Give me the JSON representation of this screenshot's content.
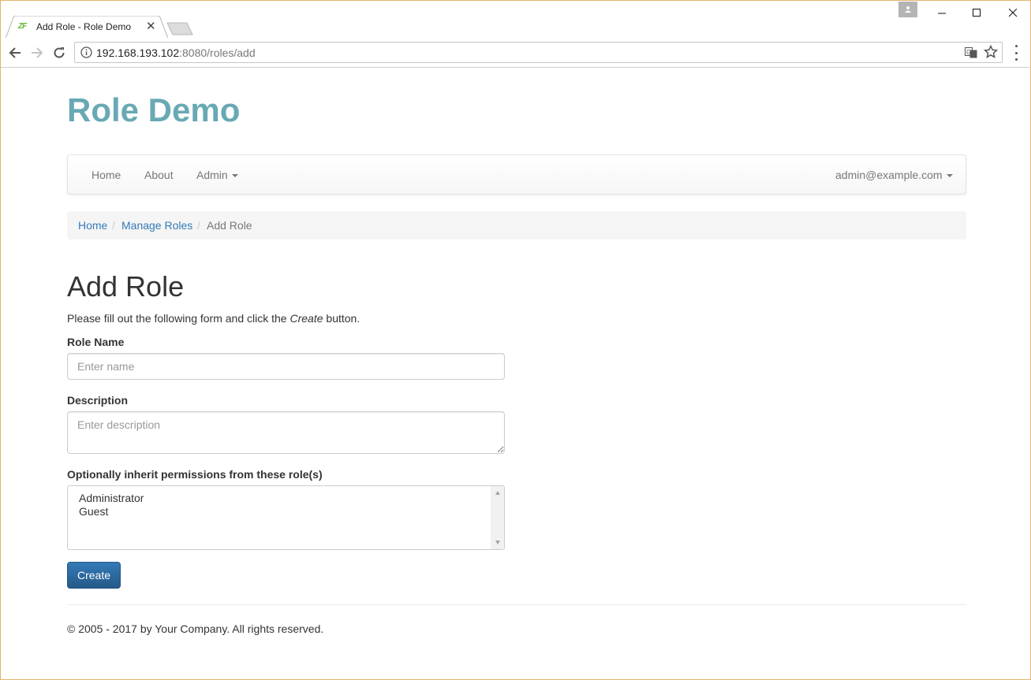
{
  "browser": {
    "tab_title": "Add Role - Role Demo",
    "tab_favicon": "ZF",
    "url_host": "192.168.193.102",
    "url_rest": ":8080/roles/add"
  },
  "site": {
    "brand": "Role Demo"
  },
  "navbar": {
    "items": [
      "Home",
      "About",
      "Admin"
    ],
    "user": "admin@example.com"
  },
  "breadcrumb": {
    "items": [
      "Home",
      "Manage Roles",
      "Add Role"
    ]
  },
  "form": {
    "heading": "Add Role",
    "intro_before": "Please fill out the following form and click the ",
    "intro_em": "Create",
    "intro_after": " button.",
    "name_label": "Role Name",
    "name_placeholder": "Enter name",
    "description_label": "Description",
    "description_placeholder": "Enter description",
    "inherit_label": "Optionally inherit permissions from these role(s)",
    "inherit_options": [
      "Administrator",
      "Guest"
    ],
    "submit_label": "Create"
  },
  "footer": {
    "text": "© 2005 - 2017 by Your Company. All rights reserved."
  },
  "colors": {
    "brand": "#68a9b4",
    "link": "#337ab7",
    "primary": "#337ab7",
    "window_border": "#e2b66a"
  }
}
